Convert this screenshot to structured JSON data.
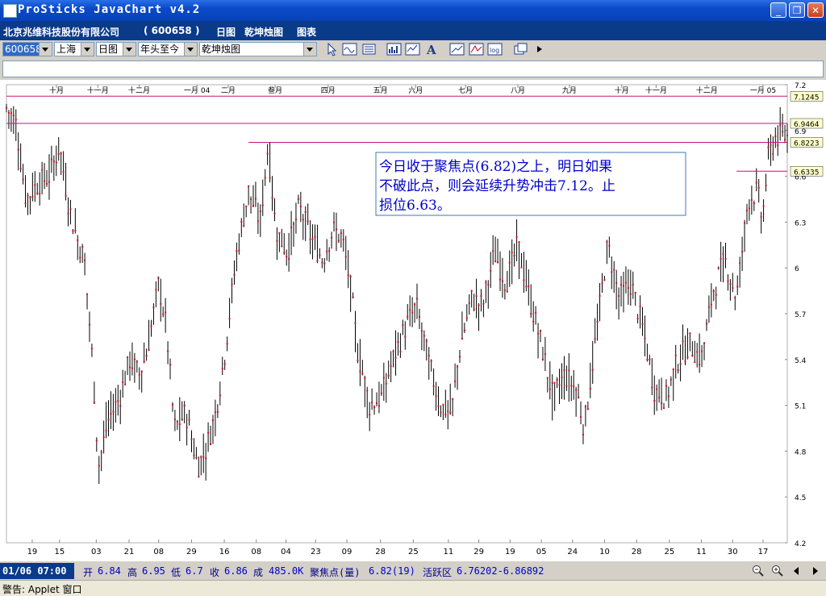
{
  "window": {
    "title": "ProSticks JavaChart v4.2"
  },
  "header": {
    "company": "北京兆维科技股份有限公司",
    "code": "( 600658 )",
    "period": "日图",
    "chart_name": "乾坤烛图",
    "table": "图表"
  },
  "toolbar": {
    "symbol": "600658",
    "market": "上海",
    "period": "日图",
    "range": "年头至今",
    "chart_type": "乾坤烛图"
  },
  "status": {
    "time": "01/06 07:00",
    "open_label": "开",
    "open": "6.84",
    "high_label": "高",
    "high": "6.95",
    "low_label": "低",
    "low": "6.7",
    "close_label": "收",
    "close": "6.86",
    "vol_label": "成",
    "vol": "485.0K",
    "focus_label": "聚焦点(量)",
    "focus": "6.82(19)",
    "active_label": "活跃区",
    "active": "6.76202-6.86892"
  },
  "footer": {
    "warning": "警告: Applet 窗口"
  },
  "colors": {
    "title_blue": "#0a4ac8",
    "header_navy": "#0a3a8a",
    "hline": "#cc1177",
    "candle": "#000000",
    "close_mark": "#d01020",
    "annotation": "#0000cc"
  },
  "chart_data": {
    "type": "candlestick",
    "ylim": [
      4.2,
      7.2
    ],
    "y_ticks": [
      "7.2",
      "6.9",
      "6.6",
      "6.3",
      "6",
      "5.7",
      "5.4",
      "5.1",
      "4.8",
      "4.5",
      "4.2"
    ],
    "month_labels": [
      "十月",
      "十一月",
      "十二月",
      "一月 04",
      "二月",
      "叁月",
      "四月",
      "五月",
      "六月",
      "七月",
      "八月",
      "九月",
      "十月",
      "十一月",
      "十二月",
      "一月 05"
    ],
    "month_positions": [
      0.064,
      0.117,
      0.17,
      0.244,
      0.284,
      0.344,
      0.412,
      0.479,
      0.524,
      0.588,
      0.655,
      0.721,
      0.788,
      0.832,
      0.897,
      0.969
    ],
    "date_labels": [
      "19",
      "15",
      "03",
      "21",
      "08",
      "29",
      "16",
      "08",
      "04",
      "23",
      "09",
      "28",
      "25",
      "11",
      "29",
      "19",
      "05",
      "24",
      "10",
      "28",
      "25",
      "11",
      "30",
      "17"
    ],
    "date_positions": [
      0.033,
      0.068,
      0.115,
      0.157,
      0.195,
      0.237,
      0.279,
      0.32,
      0.358,
      0.396,
      0.436,
      0.479,
      0.521,
      0.566,
      0.605,
      0.645,
      0.685,
      0.725,
      0.766,
      0.807,
      0.849,
      0.89,
      0.93,
      0.969
    ],
    "price_labels": [
      {
        "value": 7.1245,
        "text": "7.1245"
      },
      {
        "value": 6.9464,
        "text": "6.9464"
      },
      {
        "value": 6.8223,
        "text": "6.8223"
      },
      {
        "value": 6.6335,
        "text": "6.6335"
      }
    ],
    "hlines": [
      {
        "value": 7.1245,
        "x_start": 0.0,
        "x_end": 1.0
      },
      {
        "value": 6.9464,
        "x_start": 0.0,
        "x_end": 1.0
      },
      {
        "value": 6.8223,
        "x_start": 0.31,
        "x_end": 1.0
      },
      {
        "value": 6.6335,
        "x_start": 0.935,
        "x_end": 1.0
      }
    ],
    "waypoints": [
      [
        0,
        7.05
      ],
      [
        0.012,
        6.95
      ],
      [
        0.025,
        6.45
      ],
      [
        0.04,
        6.55
      ],
      [
        0.055,
        6.6
      ],
      [
        0.068,
        6.8
      ],
      [
        0.08,
        6.4
      ],
      [
        0.09,
        6.2
      ],
      [
        0.1,
        6.05
      ],
      [
        0.11,
        5.4
      ],
      [
        0.118,
        4.7
      ],
      [
        0.13,
        5.0
      ],
      [
        0.145,
        5.15
      ],
      [
        0.158,
        5.4
      ],
      [
        0.17,
        5.3
      ],
      [
        0.18,
        5.45
      ],
      [
        0.195,
        5.9
      ],
      [
        0.205,
        5.6
      ],
      [
        0.215,
        4.95
      ],
      [
        0.23,
        5.05
      ],
      [
        0.245,
        4.7
      ],
      [
        0.255,
        4.8
      ],
      [
        0.268,
        5.05
      ],
      [
        0.28,
        5.45
      ],
      [
        0.295,
        6.1
      ],
      [
        0.31,
        6.5
      ],
      [
        0.325,
        6.3
      ],
      [
        0.335,
        6.8
      ],
      [
        0.345,
        6.25
      ],
      [
        0.36,
        6.1
      ],
      [
        0.375,
        6.4
      ],
      [
        0.39,
        6.2
      ],
      [
        0.405,
        6.05
      ],
      [
        0.418,
        6.25
      ],
      [
        0.43,
        6.2
      ],
      [
        0.44,
        5.9
      ],
      [
        0.45,
        5.45
      ],
      [
        0.465,
        5.1
      ],
      [
        0.48,
        5.15
      ],
      [
        0.495,
        5.4
      ],
      [
        0.51,
        5.6
      ],
      [
        0.525,
        5.75
      ],
      [
        0.54,
        5.4
      ],
      [
        0.555,
        5.1
      ],
      [
        0.57,
        5.05
      ],
      [
        0.58,
        5.45
      ],
      [
        0.595,
        5.8
      ],
      [
        0.61,
        5.75
      ],
      [
        0.625,
        6.1
      ],
      [
        0.64,
        5.9
      ],
      [
        0.655,
        6.15
      ],
      [
        0.67,
        5.8
      ],
      [
        0.685,
        5.5
      ],
      [
        0.7,
        5.15
      ],
      [
        0.715,
        5.3
      ],
      [
        0.73,
        5.2
      ],
      [
        0.74,
        4.95
      ],
      [
        0.755,
        5.55
      ],
      [
        0.77,
        6.15
      ],
      [
        0.785,
        5.8
      ],
      [
        0.8,
        5.9
      ],
      [
        0.815,
        5.6
      ],
      [
        0.83,
        5.2
      ],
      [
        0.845,
        5.15
      ],
      [
        0.86,
        5.4
      ],
      [
        0.875,
        5.5
      ],
      [
        0.89,
        5.4
      ],
      [
        0.905,
        5.85
      ],
      [
        0.92,
        6.05
      ],
      [
        0.935,
        5.8
      ],
      [
        0.95,
        6.45
      ],
      [
        0.962,
        6.5
      ],
      [
        0.968,
        6.3
      ],
      [
        0.975,
        6.7
      ],
      [
        0.985,
        6.86
      ]
    ],
    "annotation": {
      "lines": [
        "今日收于聚焦点(6.82)之上，明日如果",
        "不破此点，则会延续升势冲击7.12。止",
        "损位6.63。"
      ]
    }
  }
}
